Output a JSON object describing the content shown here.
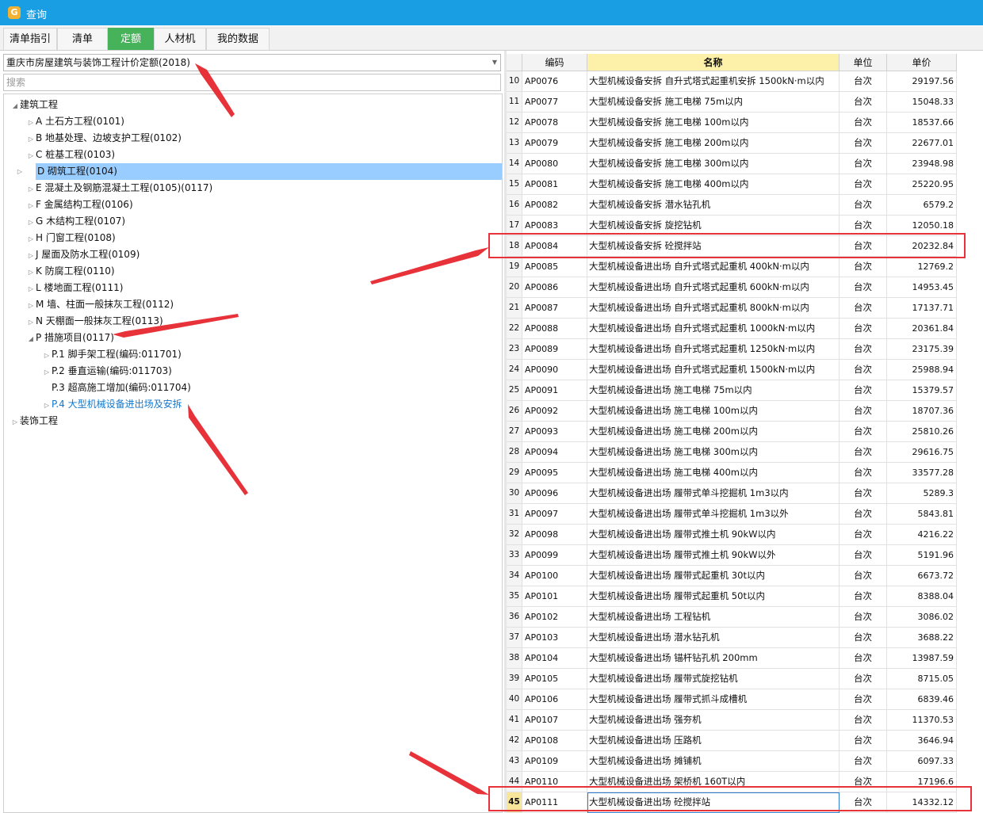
{
  "window": {
    "title": "查询"
  },
  "tabs": [
    {
      "label": "清单指引",
      "active": false
    },
    {
      "label": "清单",
      "active": false
    },
    {
      "label": "定额",
      "active": true
    },
    {
      "label": "人材机",
      "active": false
    },
    {
      "label": "我的数据",
      "active": false
    }
  ],
  "left": {
    "library": "重庆市房屋建筑与装饰工程计价定额(2018)",
    "search_placeholder": "搜索",
    "tree": [
      {
        "label": "建筑工程",
        "level": 0,
        "state": "expanded"
      },
      {
        "label": "A 土石方工程(0101)",
        "level": 1,
        "state": "collapsed"
      },
      {
        "label": "B 地基处理、边坡支护工程(0102)",
        "level": 1,
        "state": "collapsed"
      },
      {
        "label": "C 桩基工程(0103)",
        "level": 1,
        "state": "collapsed"
      },
      {
        "label": "D 砌筑工程(0104)",
        "level": 1,
        "state": "collapsed",
        "selected": true
      },
      {
        "label": "E 混凝土及钢筋混凝土工程(0105)(0117)",
        "level": 1,
        "state": "collapsed"
      },
      {
        "label": "F 金属结构工程(0106)",
        "level": 1,
        "state": "collapsed"
      },
      {
        "label": "G 木结构工程(0107)",
        "level": 1,
        "state": "collapsed"
      },
      {
        "label": "H 门窗工程(0108)",
        "level": 1,
        "state": "collapsed"
      },
      {
        "label": "J 屋面及防水工程(0109)",
        "level": 1,
        "state": "collapsed"
      },
      {
        "label": "K 防腐工程(0110)",
        "level": 1,
        "state": "collapsed"
      },
      {
        "label": "L 楼地面工程(0111)",
        "level": 1,
        "state": "collapsed"
      },
      {
        "label": "M 墙、柱面一般抹灰工程(0112)",
        "level": 1,
        "state": "collapsed"
      },
      {
        "label": "N 天棚面一般抹灰工程(0113)",
        "level": 1,
        "state": "collapsed"
      },
      {
        "label": "P 措施项目(0117)",
        "level": 1,
        "state": "expanded"
      },
      {
        "label": "P.1 脚手架工程(编码:011701)",
        "level": 2,
        "state": "collapsed"
      },
      {
        "label": "P.2 垂直运输(编码:011703)",
        "level": 2,
        "state": "collapsed"
      },
      {
        "label": "P.3 超高施工增加(编码:011704)",
        "level": 2,
        "state": "leaf"
      },
      {
        "label": "P.4 大型机械设备进出场及安拆",
        "level": 2,
        "state": "collapsed",
        "current": true
      },
      {
        "label": "装饰工程",
        "level": 0,
        "state": "collapsed"
      }
    ]
  },
  "grid": {
    "columns": {
      "code": "编码",
      "name": "名称",
      "unit": "单位",
      "price": "单价"
    },
    "rows": [
      {
        "num": "10",
        "code": "AP0076",
        "name": "大型机械设备安拆 自升式塔式起重机安拆 1500kN·m以内",
        "unit": "台次",
        "price": "29197.56"
      },
      {
        "num": "11",
        "code": "AP0077",
        "name": "大型机械设备安拆 施工电梯 75m以内",
        "unit": "台次",
        "price": "15048.33"
      },
      {
        "num": "12",
        "code": "AP0078",
        "name": "大型机械设备安拆 施工电梯 100m以内",
        "unit": "台次",
        "price": "18537.66"
      },
      {
        "num": "13",
        "code": "AP0079",
        "name": "大型机械设备安拆 施工电梯 200m以内",
        "unit": "台次",
        "price": "22677.01"
      },
      {
        "num": "14",
        "code": "AP0080",
        "name": "大型机械设备安拆 施工电梯 300m以内",
        "unit": "台次",
        "price": "23948.98"
      },
      {
        "num": "15",
        "code": "AP0081",
        "name": "大型机械设备安拆 施工电梯 400m以内",
        "unit": "台次",
        "price": "25220.95"
      },
      {
        "num": "16",
        "code": "AP0082",
        "name": "大型机械设备安拆 潜水钻孔机",
        "unit": "台次",
        "price": "6579.2"
      },
      {
        "num": "17",
        "code": "AP0083",
        "name": "大型机械设备安拆 旋挖钻机",
        "unit": "台次",
        "price": "12050.18"
      },
      {
        "num": "18",
        "code": "AP0084",
        "name": "大型机械设备安拆 砼搅拌站",
        "unit": "台次",
        "price": "20232.84",
        "boxed": true
      },
      {
        "num": "19",
        "code": "AP0085",
        "name": "大型机械设备进出场 自升式塔式起重机 400kN·m以内",
        "unit": "台次",
        "price": "12769.2"
      },
      {
        "num": "20",
        "code": "AP0086",
        "name": "大型机械设备进出场 自升式塔式起重机 600kN·m以内",
        "unit": "台次",
        "price": "14953.45"
      },
      {
        "num": "21",
        "code": "AP0087",
        "name": "大型机械设备进出场 自升式塔式起重机 800kN·m以内",
        "unit": "台次",
        "price": "17137.71"
      },
      {
        "num": "22",
        "code": "AP0088",
        "name": "大型机械设备进出场 自升式塔式起重机 1000kN·m以内",
        "unit": "台次",
        "price": "20361.84"
      },
      {
        "num": "23",
        "code": "AP0089",
        "name": "大型机械设备进出场 自升式塔式起重机 1250kN·m以内",
        "unit": "台次",
        "price": "23175.39"
      },
      {
        "num": "24",
        "code": "AP0090",
        "name": "大型机械设备进出场 自升式塔式起重机 1500kN·m以内",
        "unit": "台次",
        "price": "25988.94"
      },
      {
        "num": "25",
        "code": "AP0091",
        "name": "大型机械设备进出场 施工电梯 75m以内",
        "unit": "台次",
        "price": "15379.57"
      },
      {
        "num": "26",
        "code": "AP0092",
        "name": "大型机械设备进出场 施工电梯 100m以内",
        "unit": "台次",
        "price": "18707.36"
      },
      {
        "num": "27",
        "code": "AP0093",
        "name": "大型机械设备进出场 施工电梯 200m以内",
        "unit": "台次",
        "price": "25810.26"
      },
      {
        "num": "28",
        "code": "AP0094",
        "name": "大型机械设备进出场 施工电梯 300m以内",
        "unit": "台次",
        "price": "29616.75"
      },
      {
        "num": "29",
        "code": "AP0095",
        "name": "大型机械设备进出场 施工电梯 400m以内",
        "unit": "台次",
        "price": "33577.28"
      },
      {
        "num": "30",
        "code": "AP0096",
        "name": "大型机械设备进出场 履带式单斗挖掘机 1m3以内",
        "unit": "台次",
        "price": "5289.3"
      },
      {
        "num": "31",
        "code": "AP0097",
        "name": "大型机械设备进出场 履带式单斗挖掘机 1m3以外",
        "unit": "台次",
        "price": "5843.81"
      },
      {
        "num": "32",
        "code": "AP0098",
        "name": "大型机械设备进出场 履带式推土机 90kW以内",
        "unit": "台次",
        "price": "4216.22"
      },
      {
        "num": "33",
        "code": "AP0099",
        "name": "大型机械设备进出场 履带式推土机 90kW以外",
        "unit": "台次",
        "price": "5191.96"
      },
      {
        "num": "34",
        "code": "AP0100",
        "name": "大型机械设备进出场 履带式起重机 30t以内",
        "unit": "台次",
        "price": "6673.72"
      },
      {
        "num": "35",
        "code": "AP0101",
        "name": "大型机械设备进出场 履带式起重机 50t以内",
        "unit": "台次",
        "price": "8388.04"
      },
      {
        "num": "36",
        "code": "AP0102",
        "name": "大型机械设备进出场 工程钻机",
        "unit": "台次",
        "price": "3086.02"
      },
      {
        "num": "37",
        "code": "AP0103",
        "name": "大型机械设备进出场 潜水钻孔机",
        "unit": "台次",
        "price": "3688.22"
      },
      {
        "num": "38",
        "code": "AP0104",
        "name": "大型机械设备进出场 锚杆钻孔机 200mm",
        "unit": "台次",
        "price": "13987.59"
      },
      {
        "num": "39",
        "code": "AP0105",
        "name": "大型机械设备进出场 履带式旋挖钻机",
        "unit": "台次",
        "price": "8715.05"
      },
      {
        "num": "40",
        "code": "AP0106",
        "name": "大型机械设备进出场 履带式抓斗成槽机",
        "unit": "台次",
        "price": "6839.46"
      },
      {
        "num": "41",
        "code": "AP0107",
        "name": "大型机械设备进出场 强夯机",
        "unit": "台次",
        "price": "11370.53"
      },
      {
        "num": "42",
        "code": "AP0108",
        "name": "大型机械设备进出场 压路机",
        "unit": "台次",
        "price": "3646.94"
      },
      {
        "num": "43",
        "code": "AP0109",
        "name": "大型机械设备进出场 摊铺机",
        "unit": "台次",
        "price": "6097.33"
      },
      {
        "num": "44",
        "code": "AP0110",
        "name": "大型机械设备进出场 架桥机 160T以内",
        "unit": "台次",
        "price": "17196.6"
      },
      {
        "num": "45",
        "code": "AP0111",
        "name": "大型机械设备进出场 砼搅拌站",
        "unit": "台次",
        "price": "14332.12",
        "boxed": true,
        "current": true
      }
    ]
  },
  "colors": {
    "title_bar": "#1a9ee3",
    "active_tab": "#46b25a",
    "tree_selection": "#99ccff",
    "annotation": "#e7323a",
    "name_header": "#fdf0a8"
  },
  "icons": [
    "app-logo-icon",
    "tree-toggle-icon",
    "dropdown-arrow-icon",
    "annotation-arrow"
  ]
}
